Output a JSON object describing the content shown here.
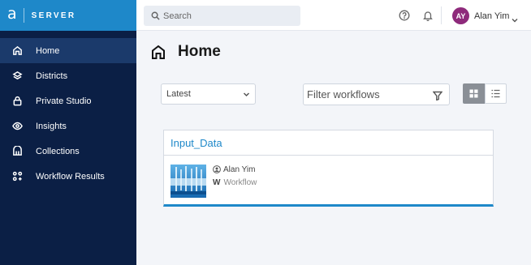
{
  "brand": {
    "logo": "a",
    "name": "SERVER"
  },
  "sidebar": {
    "items": [
      {
        "label": "Home",
        "icon": "home-icon"
      },
      {
        "label": "Districts",
        "icon": "layers-icon"
      },
      {
        "label": "Private Studio",
        "icon": "lock-icon"
      },
      {
        "label": "Insights",
        "icon": "eye-icon"
      },
      {
        "label": "Collections",
        "icon": "collections-icon"
      },
      {
        "label": "Workflow Results",
        "icon": "workflow-results-icon"
      }
    ]
  },
  "topbar": {
    "search_placeholder": "Search",
    "user": {
      "initials": "AY",
      "name": "Alan Yim"
    }
  },
  "page": {
    "title": "Home"
  },
  "controls": {
    "sort_selected": "Latest",
    "filter_placeholder": "Filter workflows"
  },
  "card": {
    "title": "Input_Data",
    "owner": "Alan Yim",
    "type_badge": "W",
    "type_label": "Workflow"
  },
  "colors": {
    "brand_blue": "#1e88c9",
    "sidebar_bg": "#0b1f45",
    "sidebar_active": "#1b3a6b",
    "avatar": "#8e2a7b"
  }
}
